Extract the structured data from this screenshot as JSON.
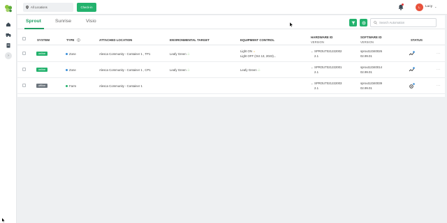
{
  "app": {
    "brand": "Alesca"
  },
  "header": {
    "location_placeholder": "All Locations",
    "checkin_label": "Check-in",
    "user_initial": "L",
    "user_name": "Lucy"
  },
  "tabs": [
    {
      "label": "Sprout",
      "active": true
    },
    {
      "label": "Sunrise",
      "active": false
    },
    {
      "label": "Visio",
      "active": false
    }
  ],
  "search": {
    "placeholder": "Search Automation"
  },
  "table": {
    "columns": {
      "system": "SYSTEM",
      "type": "TYPE",
      "location": "ATTACHED LOCATION",
      "target": "ENVIRONMENTAL TARGET",
      "equipment": "EQUIPMENT CONTROL",
      "hardware": "HARDWARE ID",
      "hardware_sub": "VERSION",
      "software": "SOFTWARE ID",
      "software_sub": "VERSION",
      "status": "STATUS"
    },
    "rows": [
      {
        "system": "online",
        "type": "Zone",
        "location": "Alesca Community - Container 1 , TP1",
        "target": "Leafy Green",
        "equipment_line1": "Light ON",
        "equipment_line2": "Light OFF (Oct 13, 2023)...",
        "hardware_id": "SPROUT021222002",
        "hardware_version": "2.1",
        "software_id": "sprout12340026",
        "software_version": "02.99.01"
      },
      {
        "system": "online",
        "type": "Zone",
        "location": "Alesca Community - Container 1 , CP1",
        "target": "Leafy Green",
        "equipment_line1": "Leafy Green",
        "equipment_line2": "",
        "hardware_id": "SPROUT021222001",
        "hardware_version": "2.1",
        "software_id": "sprout12340014",
        "software_version": "02.99.01"
      },
      {
        "system": "offline",
        "type": "Farm",
        "location": "Alesca Community - Container 1",
        "target": "",
        "equipment_line1": "",
        "equipment_line2": "",
        "hardware_id": "SPROUT021222003",
        "hardware_version": "2.1",
        "software_id": "sprout12340039",
        "software_version": "02.99.01"
      }
    ]
  },
  "colors": {
    "accent": "#23b26d",
    "offline": "#6c757d",
    "zone_dot": "#3a8fd9",
    "farm_dot": "#23b26d",
    "avatar": "#e8533d"
  },
  "icons": [
    "leaf-logo-icon",
    "home-icon",
    "truck-icon",
    "clipboard-icon",
    "chevron-right-icon",
    "pin-icon",
    "bell-icon",
    "filter-icon",
    "refresh-icon",
    "search-icon",
    "info-icon",
    "leaf-icon",
    "sun-icon",
    "status-icon",
    "more-icon"
  ]
}
